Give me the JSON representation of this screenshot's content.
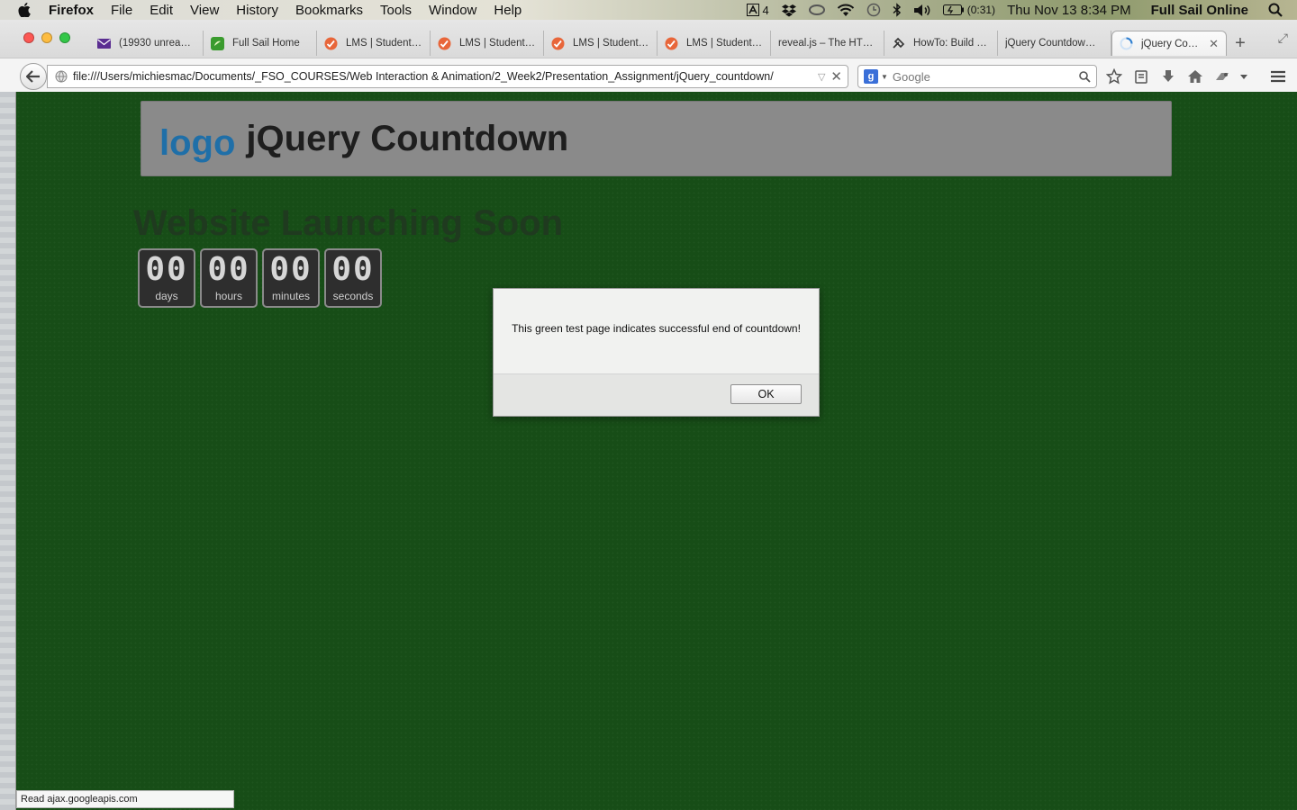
{
  "menubar": {
    "app": "Firefox",
    "items": [
      "File",
      "Edit",
      "View",
      "History",
      "Bookmarks",
      "Tools",
      "Window",
      "Help"
    ],
    "adobe_count": "4",
    "battery": "(0:31)",
    "clock": "Thu Nov 13  8:34 PM",
    "user": "Full Sail Online"
  },
  "tabs": [
    {
      "label": "(19930 unrea…",
      "icon": "mail-icon",
      "color": "#5a2d91"
    },
    {
      "label": "Full Sail Home",
      "icon": "fullsail-icon",
      "color": "#3a9b2e"
    },
    {
      "label": "LMS | Student…",
      "icon": "lms-icon",
      "color": "#e8663a"
    },
    {
      "label": "LMS | Student…",
      "icon": "lms-icon",
      "color": "#e8663a"
    },
    {
      "label": "LMS | Student…",
      "icon": "lms-icon",
      "color": "#e8663a"
    },
    {
      "label": "LMS | Student…",
      "icon": "lms-icon",
      "color": "#e8663a"
    },
    {
      "label": "reveal.js – The HT…",
      "icon": "",
      "color": ""
    },
    {
      "label": "HowTo: Build …",
      "icon": "tools-icon",
      "color": "#333"
    },
    {
      "label": "jQuery Countdow…",
      "icon": "",
      "color": ""
    }
  ],
  "active_tab": {
    "label": "jQuery Co…"
  },
  "navbar": {
    "url": "file:///Users/michiesmac/Documents/_FSO_COURSES/Web Interaction & Animation/2_Week2/Presentation_Assignment/jQuery_countdown/",
    "search_placeholder": "Google"
  },
  "page": {
    "logo": "logo",
    "title": "jQuery Countdown",
    "heading": "Website Launching Soon",
    "countdown": [
      {
        "value": "00",
        "label": "days"
      },
      {
        "value": "00",
        "label": "hours"
      },
      {
        "value": "00",
        "label": "minutes"
      },
      {
        "value": "00",
        "label": "seconds"
      }
    ]
  },
  "alert": {
    "message": "This green test page indicates successful end of countdown!",
    "ok_label": "OK"
  },
  "statusbar": {
    "text": "Read ajax.googleapis.com"
  },
  "colors": {
    "page_bg": "#174d17",
    "logo": "#1f6fa8",
    "header_bg": "#8a8a8a"
  }
}
